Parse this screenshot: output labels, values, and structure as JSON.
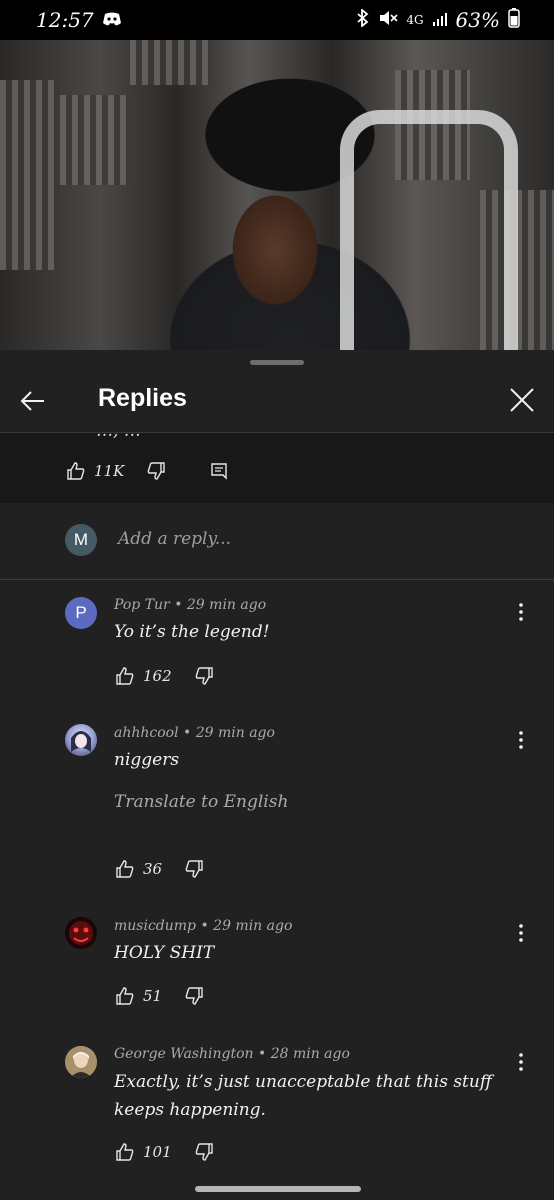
{
  "status_bar": {
    "time": "12:57",
    "network": "4G",
    "battery": "63%"
  },
  "header": {
    "title": "Replies"
  },
  "parent_comment": {
    "truncated_text": "…, …",
    "likes": "11K"
  },
  "reply_box": {
    "avatar_letter": "M",
    "placeholder": "Add a reply..."
  },
  "comments": [
    {
      "avatar_letter": "P",
      "avatar_color": "#5c6bc0",
      "author": "Pop Tur",
      "time": "29 min ago",
      "meta": "Pop Tur • 29 min ago",
      "text": "Yo it’s the legend!",
      "likes": "162"
    },
    {
      "avatar_letter": "",
      "avatar_color": "#9fa8da",
      "author": "ahhhcool",
      "time": "29 min ago",
      "meta": "ahhhcool • 29 min ago",
      "text": "niggers",
      "translate": "Translate to English",
      "likes": "36"
    },
    {
      "avatar_letter": "",
      "avatar_color": "#5a0d0d",
      "author": "musicdump",
      "time": "29 min ago",
      "meta": "musicdump • 29 min ago",
      "text": "HOLY SHIT",
      "likes": "51"
    },
    {
      "avatar_letter": "",
      "avatar_color": "#8d7a5a",
      "author": "George Washington",
      "time": "28 min ago",
      "meta": "George Washington • 28 min ago",
      "text": "Exactly, it’s just unacceptable that this stuff keeps happening.",
      "likes": "101"
    }
  ],
  "icons": {
    "back": "arrow-left-icon",
    "close": "close-icon",
    "like": "thumb-up-icon",
    "dislike": "thumb-down-icon",
    "reply": "comment-icon",
    "more": "more-vert-icon"
  },
  "colors": {
    "background": "#212121",
    "parent_background": "#181818",
    "text": "#f1f1f1",
    "secondary_text": "#aaaaaa"
  }
}
